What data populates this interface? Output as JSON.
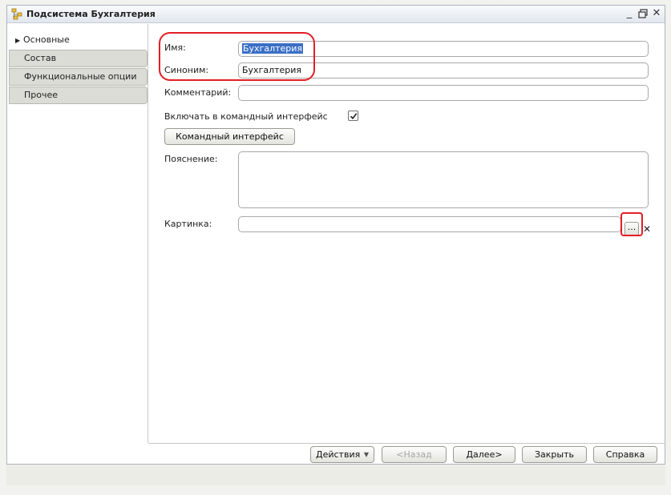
{
  "window": {
    "title": "Подсистема Бухгалтерия",
    "icon": "subsystem-icon",
    "controls": {
      "minimize": "_",
      "restore": "🗗",
      "close": "✕"
    }
  },
  "sidebar": {
    "items": [
      {
        "label": "Основные",
        "active": true
      },
      {
        "label": "Состав",
        "active": false
      },
      {
        "label": "Функциональные опции",
        "active": false
      },
      {
        "label": "Прочее",
        "active": false
      }
    ]
  },
  "form": {
    "name_label": "Имя:",
    "name_value": "Бухгалтерия",
    "synonym_label": "Синоним:",
    "synonym_value": "Бухгалтерия",
    "comment_label": "Комментарий:",
    "comment_value": "",
    "include_label": "Включать в командный интерфейс",
    "include_checked": true,
    "command_interface_button": "Командный интерфейс",
    "explanation_label": "Пояснение:",
    "picture_label": "Картинка:",
    "picture_value": "",
    "ellipsis_button": "...",
    "clear_icon": "✕"
  },
  "footer": {
    "actions_button": "Действия",
    "back_button": "<Назад",
    "next_button": "Далее>",
    "close_button": "Закрыть",
    "help_button": "Справка"
  },
  "colors": {
    "annotation": "#e31e24",
    "selection": "#3a6fc6"
  }
}
